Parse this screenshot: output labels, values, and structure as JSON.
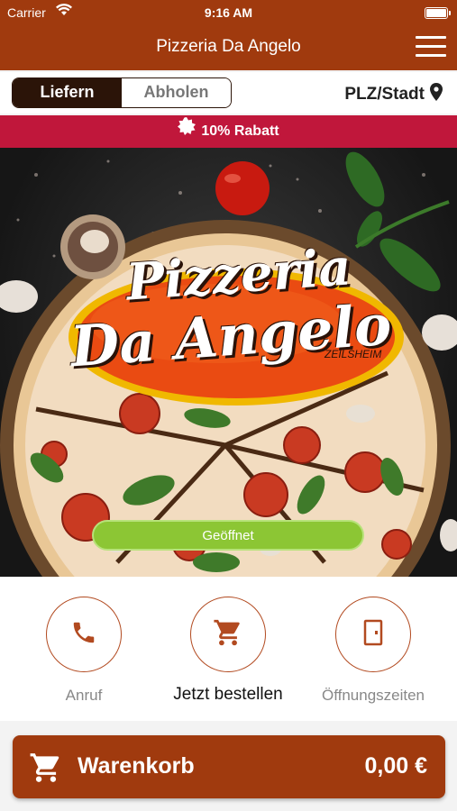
{
  "status_bar": {
    "carrier": "Carrier",
    "time": "9:16 AM"
  },
  "nav": {
    "title": "Pizzeria Da Angelo",
    "menu_icon": "hamburger-menu-icon"
  },
  "mode": {
    "deliver": "Liefern",
    "pickup": "Abholen",
    "selected": "Liefern",
    "location_label": "PLZ/Stadt"
  },
  "discount": {
    "label": "10% Rabatt"
  },
  "hero": {
    "logo_line1": "Pizzeria",
    "logo_line2": "Da Angelo",
    "logo_sub": "ZEILSHEIM",
    "open_status": "Geöffnet"
  },
  "actions": [
    {
      "label": "Anruf",
      "icon": "phone-icon"
    },
    {
      "label": "Jetzt bestellen",
      "icon": "cart-icon"
    },
    {
      "label": "Öffnungszeiten",
      "icon": "door-icon"
    }
  ],
  "cart": {
    "label": "Warenkorb",
    "total": "0,00 €"
  },
  "colors": {
    "brand": "#a03a0e",
    "discount": "#c0173b",
    "open": "#8cc634",
    "segment_dark": "#2b1408"
  }
}
